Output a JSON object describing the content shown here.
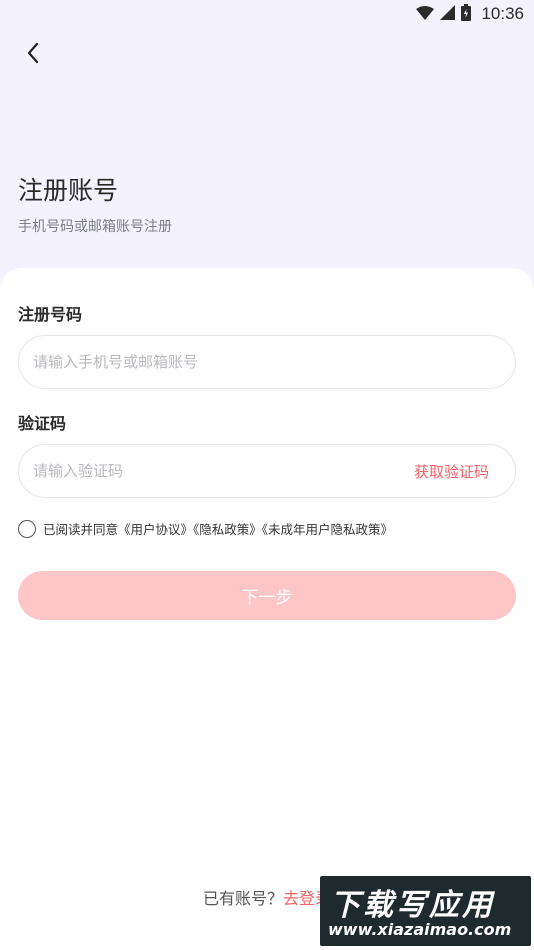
{
  "status_bar": {
    "time": "10:36",
    "icons": [
      "wifi-icon",
      "signal-icon",
      "battery-icon"
    ]
  },
  "header": {
    "back_icon": "chevron-left-icon",
    "title": "注册账号",
    "subtitle": "手机号码或邮箱账号注册"
  },
  "form": {
    "phone": {
      "label": "注册号码",
      "placeholder": "请输入手机号或邮箱账号",
      "value": ""
    },
    "code": {
      "label": "验证码",
      "placeholder": "请输入验证码",
      "value": "",
      "get_code_label": "获取验证码"
    },
    "agreement": {
      "checked": false,
      "prefix": "已阅读并同意",
      "links": [
        "《用户协议》",
        "《隐私政策》",
        "《未成年用户隐私政策》"
      ]
    },
    "next_label": "下一步"
  },
  "footer": {
    "question": "已有账号？",
    "login_link": "去登录"
  },
  "watermark": {
    "main": "下载写应用",
    "sub": "www.xiazaimao.com"
  },
  "colors": {
    "background": "#f3f2fd",
    "accent": "#f0646a",
    "button_disabled": "#ffc6c8"
  }
}
